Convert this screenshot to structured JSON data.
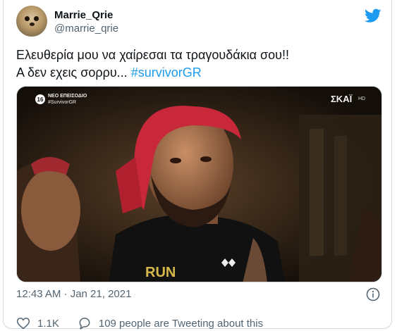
{
  "user": {
    "display_name": "Marrie_Qrie",
    "handle": "@marrie_qrie"
  },
  "tweet": {
    "line1": "Ελευθερία μου να χαίρεσαι τα τραγουδάκια σου!!",
    "line2_prefix": "Α δεν εχεις σορρυ... ",
    "hashtag": "#survivorGR"
  },
  "media": {
    "badge_number": "16",
    "badge_line1": "ΝΕΟ ΕΠΕΙΣΟΔΙΟ",
    "badge_line2": "#SurvivorGR",
    "channel_logo": "ΣΚΑΪ",
    "channel_hd": "HD",
    "shirt_text": "RUN"
  },
  "meta": {
    "timestamp": "12:43 AM · Jan 21, 2021"
  },
  "actions": {
    "likes": "1.1K",
    "tweeting": "109 people are Tweeting about this"
  },
  "colors": {
    "accent": "#1d9bf0",
    "secondary_text": "#536471",
    "like_icon": "heart-icon",
    "reply_icon": "speech-bubble-icon"
  }
}
